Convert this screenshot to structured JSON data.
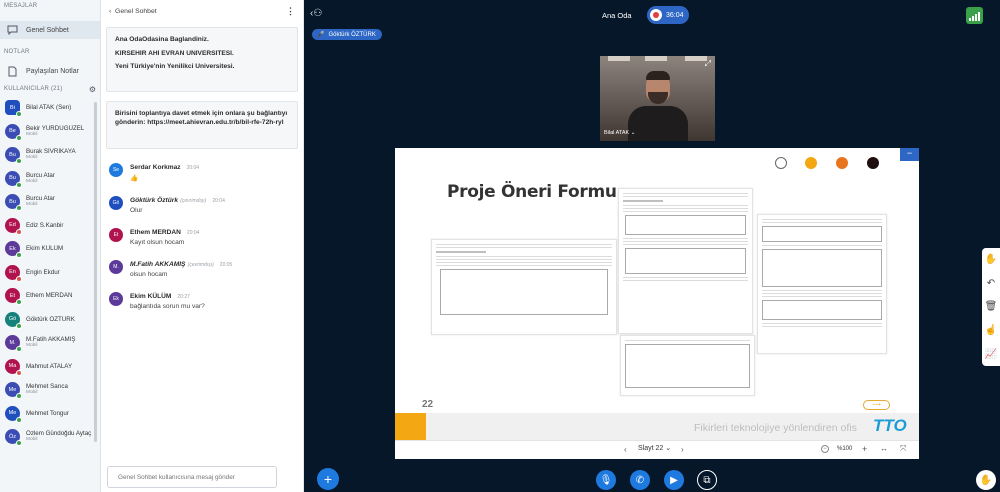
{
  "sidebar": {
    "messages_title": "MESAJLAR",
    "public_chat": "Genel Sohbet",
    "notes_title": "NOTLAR",
    "shared_notes": "Paylaşılan Notlar",
    "users_title": "KULLANICILAR (21)",
    "users": [
      {
        "initials": "Bi",
        "name": "Bilal ATAK (Sen)",
        "sub": "",
        "color": "#1f4fbf",
        "round": false,
        "status": "green"
      },
      {
        "initials": "Be",
        "name": "Bekir YURDUGÜZEL",
        "sub": "Mobil",
        "color": "#3b4db4",
        "round": true,
        "status": "green"
      },
      {
        "initials": "Bu",
        "name": "Burak SİVRİKAYA",
        "sub": "Mobil",
        "color": "#3b4db4",
        "round": true,
        "status": "green"
      },
      {
        "initials": "Bu",
        "name": "Burcu Atar",
        "sub": "Mobil",
        "color": "#3b4db4",
        "round": true,
        "status": "green"
      },
      {
        "initials": "Bu",
        "name": "Burcu Atar",
        "sub": "Mobil",
        "color": "#3b4db4",
        "round": true,
        "status": "green"
      },
      {
        "initials": "Ed",
        "name": "Ediz S.Kanbir",
        "sub": "",
        "color": "#b0134d",
        "round": true,
        "status": "red"
      },
      {
        "initials": "Ek",
        "name": "Ekim KÜLÜM",
        "sub": "",
        "color": "#5b3a99",
        "round": true,
        "status": "green"
      },
      {
        "initials": "En",
        "name": "Engin Ekdur",
        "sub": "",
        "color": "#b0134d",
        "round": true,
        "status": "red"
      },
      {
        "initials": "Et",
        "name": "Ethem MERDAN",
        "sub": "",
        "color": "#b0134d",
        "round": true,
        "status": "green"
      },
      {
        "initials": "Gö",
        "name": "Göktürk ÖZTÜRK",
        "sub": "",
        "color": "#16807a",
        "round": true,
        "status": "green"
      },
      {
        "initials": "M.",
        "name": "M.Fatih AKKAMIŞ",
        "sub": "Mobil",
        "color": "#5b3a99",
        "round": true,
        "status": "green"
      },
      {
        "initials": "Ma",
        "name": "Mahmut ATALAY",
        "sub": "",
        "color": "#b0134d",
        "round": true,
        "status": "red"
      },
      {
        "initials": "Me",
        "name": "Mehmet Sarıca",
        "sub": "Mobil",
        "color": "#3b4db4",
        "round": true,
        "status": "green"
      },
      {
        "initials": "Me",
        "name": "Mehmet Tongur",
        "sub": "",
        "color": "#1f4fbf",
        "round": true,
        "status": "green"
      },
      {
        "initials": "Öz",
        "name": "Özlem Gündoğdu Aytaç",
        "sub": "Mobil",
        "color": "#3b4db4",
        "round": true,
        "status": "green"
      }
    ]
  },
  "chat": {
    "title": "Genel Sohbet",
    "welcome": [
      "Ana OdaOdasina Baglandiniz.",
      "KIRSEHIR AHI EVRAN UNIVERSITESI.",
      "Yeni Türkiye'nin Yenilikci Universitesi."
    ],
    "invite": "Birisini toplantıya davet etmek için onlara şu bağlantıyı gönderin: https://meet.ahievran.edu.tr/b/bil-rfe-72h-ryl",
    "messages": [
      {
        "initials": "Se",
        "name": "Serdar Korkmaz",
        "note": "",
        "time": "20:04",
        "text": "👍",
        "color": "#1f7ae0",
        "italic": false
      },
      {
        "initials": "Gö",
        "name": "Göktürk Öztürk",
        "note": "(çevrimdışı)",
        "time": "20:04",
        "text": "Olur",
        "color": "#1f4fbf",
        "italic": true
      },
      {
        "initials": "Et",
        "name": "Ethem MERDAN",
        "note": "",
        "time": "20:04",
        "text": "Kayıt olsun hocam",
        "color": "#b0134d",
        "italic": false
      },
      {
        "initials": "M.",
        "name": "M.Fatih AKKAMIŞ",
        "note": "(çevrimdışı)",
        "time": "20:05",
        "text": "olsun hocam",
        "color": "#5b3a99",
        "italic": true
      },
      {
        "initials": "Ek",
        "name": "Ekim KÜLÜM",
        "note": "",
        "time": "20:27",
        "text": "bağlantıda sorun mu var?",
        "color": "#5b3a99",
        "italic": false
      }
    ],
    "input_placeholder": "Genel Sohbet kullanıcısına mesaj gönder"
  },
  "main": {
    "room_title": "Ana Oda",
    "record_time": "36:04",
    "talker": "Göktürk ÖZTÜRK",
    "webcam_name": "Bilal ATAK",
    "slide": {
      "title": "Proje Öneri Formu",
      "number": "22",
      "footer": "Fikirleri teknolojiye yönlendiren ofis",
      "logo": "TTO"
    },
    "slide_select": "Slayt 22",
    "zoom": "%100",
    "colors": [
      "#ffffff",
      "#f3a712",
      "#e8741d",
      "#1f0f0f"
    ]
  }
}
